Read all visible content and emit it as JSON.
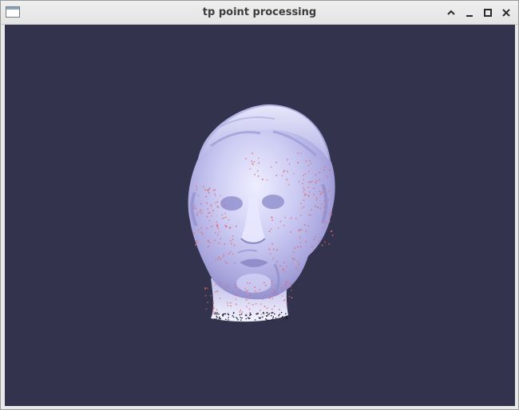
{
  "window": {
    "title": "tp point processing",
    "icons": {
      "app": "window-app-icon",
      "minimize_up": "chevron-up-icon",
      "minimize": "minimize-icon",
      "maximize": "maximize-icon",
      "close": "close-icon"
    }
  },
  "viewport": {
    "background_color": "#33334d",
    "mesh_color": "#c9c8f2",
    "point_color": "#e06a6a",
    "content": "3d-head-scan"
  }
}
